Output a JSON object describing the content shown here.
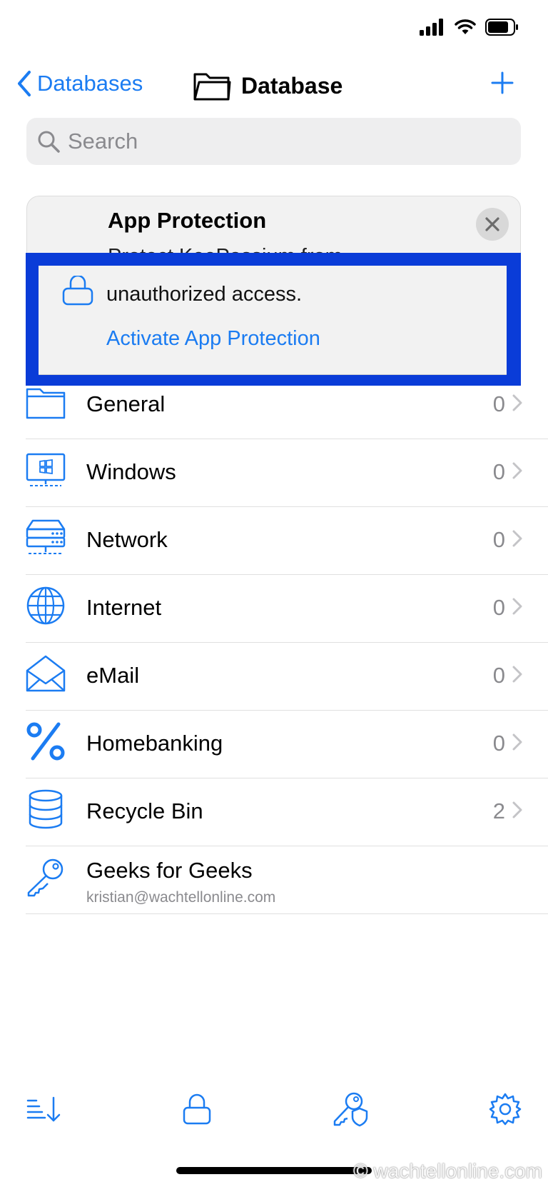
{
  "nav": {
    "back_label": "Databases",
    "title": "Database"
  },
  "search": {
    "placeholder": "Search"
  },
  "promo": {
    "title": "App Protection",
    "hidden_text": "Protect KeePassium from",
    "body": "unauthorized access.",
    "link": "Activate App Protection"
  },
  "groups": [
    {
      "label": "General",
      "count": "0",
      "icon": "folder-icon"
    },
    {
      "label": "Windows",
      "count": "0",
      "icon": "windows-computer-icon"
    },
    {
      "label": "Network",
      "count": "0",
      "icon": "server-icon"
    },
    {
      "label": "Internet",
      "count": "0",
      "icon": "globe-icon"
    },
    {
      "label": "eMail",
      "count": "0",
      "icon": "envelope-icon"
    },
    {
      "label": "Homebanking",
      "count": "0",
      "icon": "percent-icon"
    },
    {
      "label": "Recycle Bin",
      "count": "2",
      "icon": "database-icon"
    }
  ],
  "entry": {
    "title": "Geeks for Geeks",
    "username": "kristian@wachtellonline.com",
    "icon": "key-icon"
  },
  "tabbar": {
    "items": [
      "sort-icon",
      "lock-icon",
      "password-generator-icon",
      "gear-icon"
    ]
  },
  "watermark": "© wachtellonline.com",
  "colors": {
    "accent": "#1b7cf2",
    "highlight": "#0a3cd8"
  }
}
